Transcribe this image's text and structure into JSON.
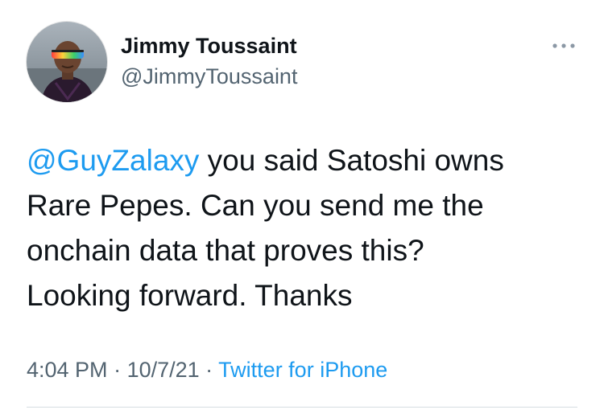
{
  "author": {
    "name": "Jimmy Toussaint",
    "handle": "@JimmyToussaint",
    "avatar_icon": "profile-photo"
  },
  "more_icon": "ellipsis-icon",
  "tweet": {
    "mention": "@GuyZalaxy",
    "line1_rest": " you said Satoshi owns",
    "line2": "Rare Pepes. Can you send me the",
    "line3": "onchain data that proves this?",
    "line4": "Looking forward. Thanks"
  },
  "meta": {
    "time": "4:04 PM",
    "sep1": " · ",
    "date": "10/7/21",
    "sep2": " · ",
    "source": "Twitter for iPhone"
  },
  "colors": {
    "link": "#1d9bf0",
    "secondary_text": "#536471",
    "primary_text": "#0f1419"
  }
}
